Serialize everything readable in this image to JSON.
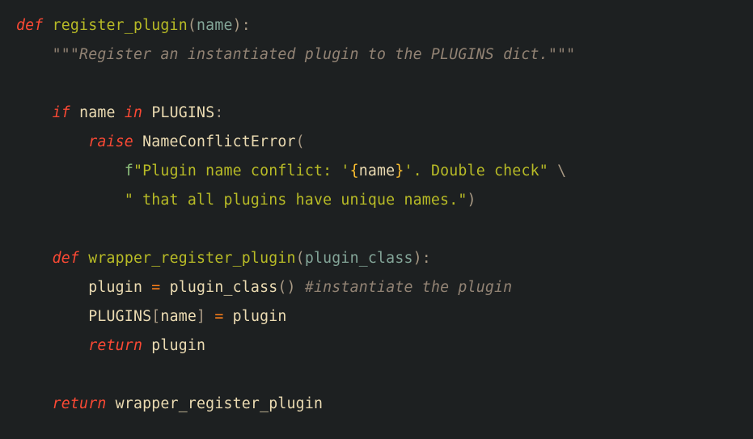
{
  "code": {
    "l1": {
      "def": "def",
      "sp": " ",
      "fn": "register_plugin",
      "lp": "(",
      "p1": "name",
      "rp": ")",
      "colon": ":"
    },
    "l2": {
      "indent": "    ",
      "doc": "\"\"\"Register an instantiated plugin to the PLUGINS dict.\"\"\""
    },
    "l3": "",
    "l4": {
      "indent": "    ",
      "if": "if",
      "sp": " ",
      "n": "name",
      "sp2": " ",
      "in": "in",
      "sp3": " ",
      "P": "PLUGINS",
      "colon": ":"
    },
    "l5": {
      "indent": "        ",
      "raise": "raise",
      "sp": " ",
      "err": "NameConflictError",
      "lp": "("
    },
    "l6": {
      "indent": "            ",
      "f": "f",
      "s1": "\"Plugin name conflict: '",
      "lb": "{",
      "nm": "name",
      "rb": "}",
      "s2": "'. Double check\"",
      "sp": " ",
      "bs": "\\"
    },
    "l7": {
      "indent": "            ",
      "s": "\" that all plugins have unique names.\"",
      "rp": ")"
    },
    "l8": "",
    "l9": {
      "indent": "    ",
      "def": "def",
      "sp": " ",
      "fn": "wrapper_register_plugin",
      "lp": "(",
      "p1": "plugin_class",
      "rp": ")",
      "colon": ":"
    },
    "l10": {
      "indent": "        ",
      "v": "plugin",
      "sp": " ",
      "eq": "=",
      "sp2": " ",
      "cls": "plugin_class",
      "par": "()",
      "sp3": " ",
      "c": "#instantiate the plugin"
    },
    "l11": {
      "indent": "        ",
      "P": "PLUGINS",
      "lb": "[",
      "n": "name",
      "rb": "]",
      "sp": " ",
      "eq": "=",
      "sp2": " ",
      "v": "plugin"
    },
    "l12": {
      "indent": "        ",
      "ret": "return",
      "sp": " ",
      "v": "plugin"
    },
    "l13": "",
    "l14": {
      "indent": "    ",
      "ret": "return",
      "sp": " ",
      "fn": "wrapper_register_plugin"
    }
  },
  "chart_data": {
    "type": "code",
    "language": "python",
    "plain_text": "def register_plugin(name):\n    \"\"\"Register an instantiated plugin to the PLUGINS dict.\"\"\"\n\n    if name in PLUGINS:\n        raise NameConflictError(\n            f\"Plugin name conflict: '{name}'. Double check\" \\\n            \" that all plugins have unique names.\")\n\n    def wrapper_register_plugin(plugin_class):\n        plugin = plugin_class() #instantiate the plugin\n        PLUGINS[name] = plugin\n        return plugin\n\n    return wrapper_register_plugin"
  }
}
